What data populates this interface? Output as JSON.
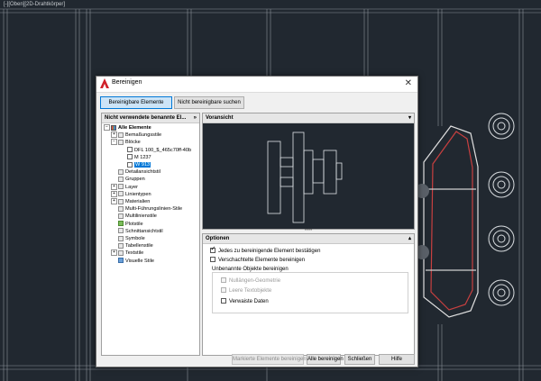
{
  "viewport": {
    "title": "[-][Oben][2D-Drahtkörper]"
  },
  "dialog": {
    "title": "Bereinigen",
    "close_icon": "✕",
    "tabs": {
      "purgeable": "Bereinigbare Elemente",
      "non_purgeable": "Nicht bereinigbare suchen"
    },
    "tree_header": "Nicht verwendete benannte El...",
    "tree_header_chevron": "»",
    "tree": [
      {
        "label": "Alle Elemente",
        "toggle": "−",
        "icon": "mixed",
        "bold": true
      },
      {
        "label": "Bemaßungsstile",
        "toggle": "+",
        "icon": "folder"
      },
      {
        "label": "Blöcke",
        "toggle": "−",
        "icon": "folder"
      },
      {
        "label": "DFL 100_$_465c70ff-40b",
        "icon": "doc"
      },
      {
        "label": "M 1237",
        "icon": "doc"
      },
      {
        "label": "W 913",
        "icon": "doc",
        "selected": true
      },
      {
        "label": "Detailansichtstil",
        "icon": "folder"
      },
      {
        "label": "Gruppen",
        "icon": "folder"
      },
      {
        "label": "Layer",
        "toggle": "+",
        "icon": "folder"
      },
      {
        "label": "Linientypen",
        "toggle": "+",
        "icon": "folder"
      },
      {
        "label": "Materialien",
        "toggle": "+",
        "icon": "folder"
      },
      {
        "label": "Multi-Führungslinien-Stile",
        "icon": "folder"
      },
      {
        "label": "Multilinienstile",
        "icon": "folder"
      },
      {
        "label": "Plotstile",
        "icon": "green"
      },
      {
        "label": "Schnittansichtstil",
        "icon": "folder"
      },
      {
        "label": "Symbole",
        "icon": "folder"
      },
      {
        "label": "Tabellenstile",
        "icon": "folder"
      },
      {
        "label": "Textstile",
        "toggle": "+",
        "icon": "folder"
      },
      {
        "label": "Visuelle Stile",
        "icon": "blue"
      }
    ],
    "preview": {
      "header": "Voransicht",
      "collapse_icon": "▾"
    },
    "splitter_grip": "••••",
    "options": {
      "header": "Optionen",
      "collapse_icon": "▴",
      "confirm_each": {
        "label": "Jedes zu bereinigende Element bestätigen",
        "checked": true
      },
      "purge_nested": {
        "label": "Verschachtelte Elemente bereinigen",
        "checked": false
      },
      "unnamed_group": "Unbenannte Objekte bereinigen",
      "zero_length": {
        "label": "Nullängen-Geometrie",
        "checked": false,
        "disabled": true
      },
      "empty_text": {
        "label": "Leere Textobjekte",
        "checked": false,
        "disabled": true
      },
      "orphaned_data": {
        "label": "Verwaiste Daten",
        "checked": false
      }
    },
    "buttons": {
      "purge_checked": "Markierte Elemente bereinigen",
      "purge_all": "Alle bereinigen",
      "close": "Schließen",
      "help": "Hilfe"
    }
  }
}
